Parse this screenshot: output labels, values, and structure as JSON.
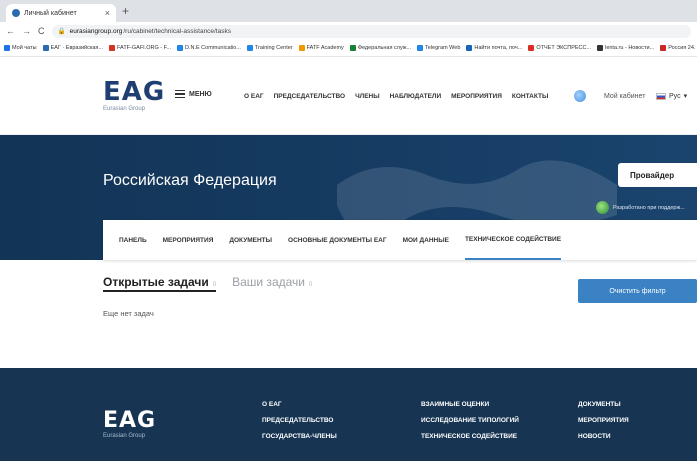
{
  "browser": {
    "tab_title": "Личный кабинет",
    "tab_close": "×",
    "new_tab": "+",
    "url_domain": "eurasiangroup.org",
    "url_path": "/ru/cabinet/technical-assistance/tasks",
    "bookmarks": [
      {
        "label": "Мой чаты",
        "color": "#1a73e8"
      },
      {
        "label": "ЕАГ · Евразийская...",
        "color": "#2b6cb0"
      },
      {
        "label": "FATF-GAFI.ORG - F...",
        "color": "#d93025"
      },
      {
        "label": "D.N.E Communicatio...",
        "color": "#1e88e5"
      },
      {
        "label": "Training Center",
        "color": "#1e88e5"
      },
      {
        "label": "FATF Academy",
        "color": "#f29900"
      },
      {
        "label": "Федеральная служ...",
        "color": "#188038"
      },
      {
        "label": "Telegram Web",
        "color": "#1e88e5"
      },
      {
        "label": "Найти почта, поч...",
        "color": "#1565c0"
      },
      {
        "label": "ОТЧЕТ ЭКСПРЕСС...",
        "color": "#d93025"
      },
      {
        "label": "lenta.ru - Новости...",
        "color": "#333333"
      },
      {
        "label": "Россия 24. Пря...",
        "color": "#c62828"
      }
    ]
  },
  "header": {
    "logo_text": "EAG",
    "logo_sub": "Eurasian Group",
    "menu_label": "МЕНЮ",
    "nav": [
      "О ЕАГ",
      "ПРЕДСЕДАТЕЛЬСТВО",
      "ЧЛЕНЫ",
      "НАБЛЮДАТЕЛИ",
      "МЕРОПРИЯТИЯ",
      "КОНТАКТЫ"
    ],
    "cabinet": "Мой кабинет",
    "lang": "Рус"
  },
  "hero": {
    "title": "Российская Федерация",
    "provider_button": "Провайдер",
    "dev_note": "Разработано при поддерж..."
  },
  "tabs": [
    "ПАНЕЛЬ",
    "МЕРОПРИЯТИЯ",
    "ДОКУМЕНТЫ",
    "ОСНОВНЫЕ ДОКУМЕНТЫ ЕАГ",
    "МОИ ДАННЫЕ",
    "ТЕХНИЧЕСКОЕ СОДЕЙСТВИЕ"
  ],
  "tasks": {
    "open_label": "Открытые задачи",
    "open_count": "0",
    "yours_label": "Ваши задачи",
    "yours_count": "0",
    "empty_text": "Еще нет задач",
    "clear_filter": "Очистить фильтр"
  },
  "footer": {
    "logo_text": "EAG",
    "logo_sub": "Eurasian Group",
    "col1": [
      "О ЕАГ",
      "ПРЕДСЕДАТЕЛЬСТВО",
      "ГОСУДАРСТВА-ЧЛЕНЫ"
    ],
    "col2": [
      "ВЗАИМНЫЕ ОЦЕНКИ",
      "ИССЛЕДОВАНИЕ ТИПОЛОГИЙ",
      "ТЕХНИЧЕСКОЕ СОДЕЙСТВИЕ"
    ],
    "col3": [
      "ДОКУМЕНТЫ",
      "МЕРОПРИЯТИЯ",
      "НОВОСТИ"
    ]
  }
}
